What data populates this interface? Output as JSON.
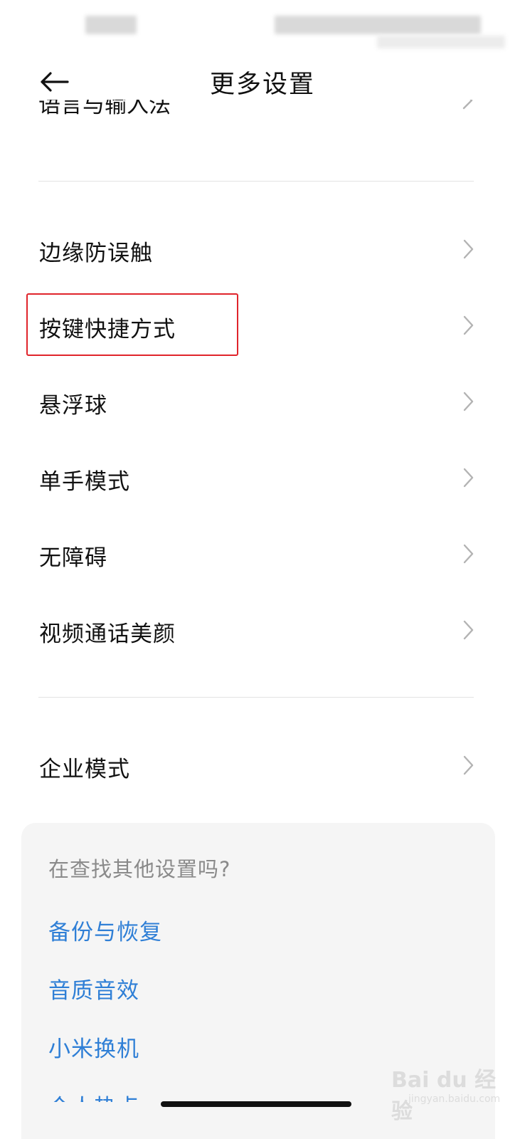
{
  "header": {
    "title": "更多设置"
  },
  "list": {
    "partial_top_label": "语言与输入法",
    "items": [
      {
        "label": "边缘防误触"
      },
      {
        "label": "按键快捷方式"
      },
      {
        "label": "悬浮球"
      },
      {
        "label": "单手模式"
      },
      {
        "label": "无障碍"
      },
      {
        "label": "视频通话美颜"
      },
      {
        "label": "企业模式"
      }
    ]
  },
  "suggestions": {
    "title": "在查找其他设置吗?",
    "links": [
      {
        "label": "备份与恢复"
      },
      {
        "label": "音质音效"
      },
      {
        "label": "小米换机"
      },
      {
        "label": "个人热点"
      }
    ]
  },
  "watermark": {
    "brand": "Bai du 经验",
    "url": "jingyan.baidu.com"
  },
  "colors": {
    "link": "#2f7fd6",
    "highlight": "#e0242b",
    "divider": "#e3e3e3",
    "card_bg": "#f5f5f5"
  },
  "icons": {
    "back": "arrow-left-icon",
    "row_chevron": "chevron-right-icon"
  }
}
